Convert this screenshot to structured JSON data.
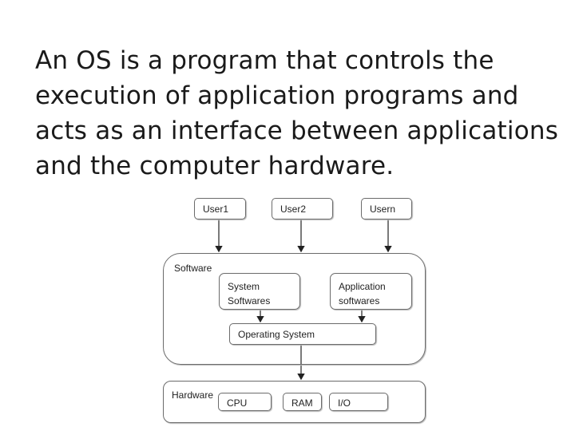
{
  "slide": {
    "text": "An OS is a program that controls the execution of application programs and acts as an interface between applications and the computer hardware."
  },
  "diagram": {
    "users": [
      "User1",
      "User2",
      "Usern"
    ],
    "software": {
      "label": "Software",
      "system": [
        "System",
        "Softwares"
      ],
      "application": [
        "Application",
        "softwares"
      ],
      "os": "Operating System"
    },
    "hardware": {
      "label": "Hardware",
      "items": [
        "CPU",
        "RAM",
        "I/O"
      ]
    }
  }
}
